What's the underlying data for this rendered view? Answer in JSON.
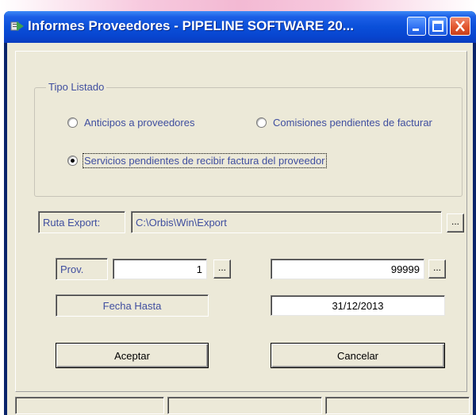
{
  "window": {
    "title": "Informes Proveedores - PIPELINE SOFTWARE 20..."
  },
  "group": {
    "legend": "Tipo Listado",
    "options": [
      {
        "label": "Anticipos a proveedores",
        "selected": false
      },
      {
        "label": "Comisiones pendientes de facturar",
        "selected": false
      },
      {
        "label": "Servicios pendientes de recibir factura del proveedor",
        "selected": true
      }
    ]
  },
  "export": {
    "label": "Ruta Export:",
    "path": "C:\\Orbis\\Win\\Export",
    "browse": "..."
  },
  "prov": {
    "label": "Prov.",
    "from": "1",
    "to": "99999",
    "browse_from": "...",
    "browse_to": "..."
  },
  "fecha": {
    "label": "Fecha Hasta",
    "value": "31/12/2013"
  },
  "buttons": {
    "accept": "Aceptar",
    "cancel": "Cancelar"
  },
  "colors": {
    "titlebar": "#0a4fd9",
    "label_text": "#3f4e9f",
    "face": "#ece9d8",
    "close_button": "#e2562e"
  },
  "icons": [
    "app-icon",
    "minimize-icon",
    "maximize-icon",
    "close-icon",
    "radio-icon"
  ]
}
